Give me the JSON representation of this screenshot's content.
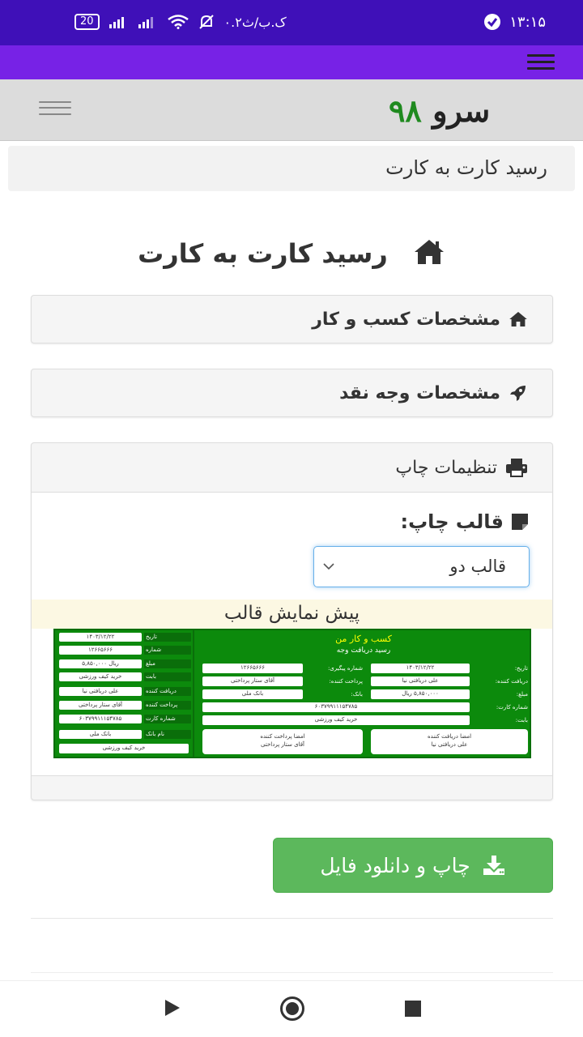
{
  "status_bar": {
    "time": "۱۳:۱۵",
    "speed": "۰.۲ک.ب/ث",
    "battery": "20"
  },
  "navbar": {
    "brand_word": "سرو",
    "brand_number": "۹۸"
  },
  "breadcrumb": "رسید کارت به کارت",
  "page_title": "رسید کارت به کارت",
  "panels": {
    "business": "مشخصات کسب و کار",
    "cash": "مشخصات وجه نقد",
    "print": "تنظیمات چاپ"
  },
  "print_settings": {
    "template_label": "قالب چاپ:",
    "template_value": "قالب دو",
    "preview_label": "پیش نمایش قالب"
  },
  "receipt": {
    "title": "کسب و کار من",
    "subtitle": "رسید دریافت وجه",
    "date_label": "تاریخ:",
    "date_value": "۱۴۰۳/۱۲/۲۲",
    "tracking_label": "شماره پیگیری:",
    "tracking_value": "۱۲۶۶۵۶۶۶",
    "receiver_label": "دریافت کننده:",
    "receiver_value": "علی دریافتی نیا",
    "payer_label": "پرداخت کننده:",
    "payer_value": "آقای ستار پرداختی",
    "amount_label": "مبلغ:",
    "amount_value": "۵,۸۵۰,۰۰۰ ریال",
    "bank_label": "بانک:",
    "bank_value": "بانک ملی",
    "card_label": "شماره کارت:",
    "card_value": "۶۰۳۷۹۹۱۱۱۵۴۷۸۵",
    "for_label": "بابت:",
    "for_value": "خرید کیف ورزشی",
    "sig_receiver_label": "امضا دریافت کننده",
    "sig_receiver_value": "علی دریافتی نیا",
    "sig_payer_label": "امضا پرداخت کننده",
    "sig_payer_value": "آقای ستار پرداختی",
    "left": {
      "date_label": "تاریخ",
      "number_label": "شماره",
      "amount_label": "مبلغ",
      "for_label": "بابت",
      "receiver_label": "دریافت کننده",
      "payer_label": "پرداخت کننده",
      "card_label": "شماره کارت",
      "bank_label": "نام بانک"
    }
  },
  "download_button": "چاپ و دانلود فایل"
}
